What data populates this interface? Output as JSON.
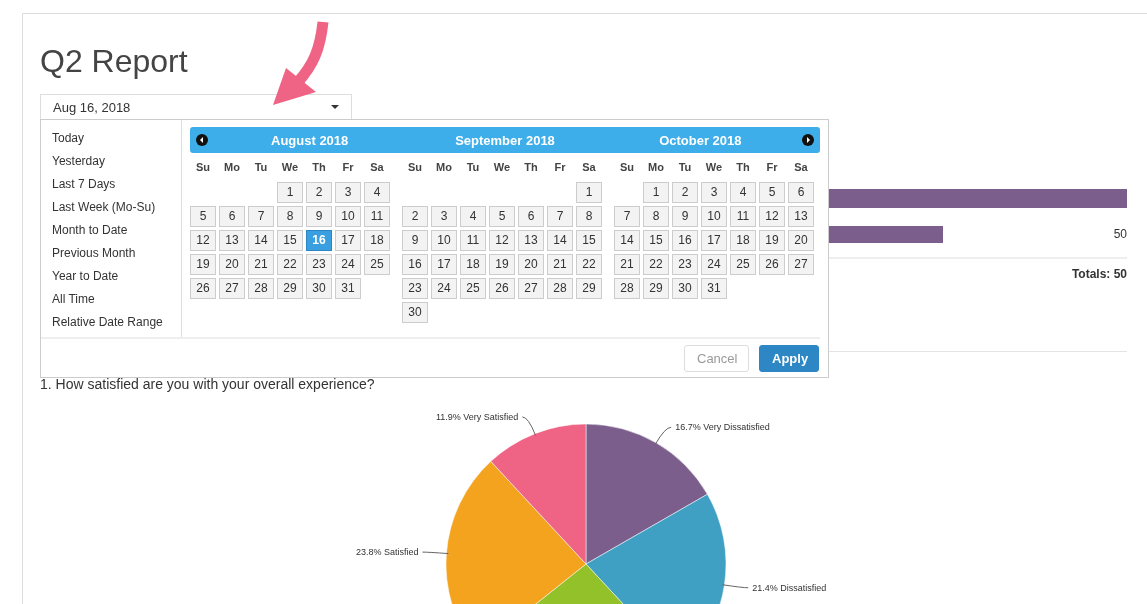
{
  "page": {
    "title": "Q2 Report"
  },
  "date_select": {
    "value": "Aug 16, 2018"
  },
  "date_picker": {
    "ranges": [
      "Today",
      "Yesterday",
      "Last 7 Days",
      "Last Week (Mo-Su)",
      "Month to Date",
      "Previous Month",
      "Year to Date",
      "All Time",
      "Relative Date Range"
    ],
    "months": [
      {
        "title": "August 2018",
        "weekdays": [
          "Su",
          "Mo",
          "Tu",
          "We",
          "Th",
          "Fr",
          "Sa"
        ],
        "weeks": [
          [
            {
              "kind": "blank"
            },
            {
              "kind": "blank"
            },
            {
              "kind": "blank"
            },
            {
              "kind": "day",
              "day": "1",
              "selected": false
            },
            {
              "kind": "day",
              "day": "2",
              "selected": false
            },
            {
              "kind": "day",
              "day": "3",
              "selected": false
            },
            {
              "kind": "day",
              "day": "4",
              "selected": false
            }
          ],
          [
            {
              "kind": "day",
              "day": "5",
              "selected": false
            },
            {
              "kind": "day",
              "day": "6",
              "selected": false
            },
            {
              "kind": "day",
              "day": "7",
              "selected": false
            },
            {
              "kind": "day",
              "day": "8",
              "selected": false
            },
            {
              "kind": "day",
              "day": "9",
              "selected": false
            },
            {
              "kind": "day",
              "day": "10",
              "selected": false
            },
            {
              "kind": "day",
              "day": "11",
              "selected": false
            }
          ],
          [
            {
              "kind": "day",
              "day": "12",
              "selected": false
            },
            {
              "kind": "day",
              "day": "13",
              "selected": false
            },
            {
              "kind": "day",
              "day": "14",
              "selected": false
            },
            {
              "kind": "day",
              "day": "15",
              "selected": false
            },
            {
              "kind": "day",
              "day": "16",
              "selected": true
            },
            {
              "kind": "day",
              "day": "17",
              "selected": false
            },
            {
              "kind": "day",
              "day": "18",
              "selected": false
            }
          ],
          [
            {
              "kind": "day",
              "day": "19",
              "selected": false
            },
            {
              "kind": "day",
              "day": "20",
              "selected": false
            },
            {
              "kind": "day",
              "day": "21",
              "selected": false
            },
            {
              "kind": "day",
              "day": "22",
              "selected": false
            },
            {
              "kind": "day",
              "day": "23",
              "selected": false
            },
            {
              "kind": "day",
              "day": "24",
              "selected": false
            },
            {
              "kind": "day",
              "day": "25",
              "selected": false
            }
          ],
          [
            {
              "kind": "day",
              "day": "26",
              "selected": false
            },
            {
              "kind": "day",
              "day": "27",
              "selected": false
            },
            {
              "kind": "day",
              "day": "28",
              "selected": false
            },
            {
              "kind": "day",
              "day": "29",
              "selected": false
            },
            {
              "kind": "day",
              "day": "30",
              "selected": false
            },
            {
              "kind": "day",
              "day": "31",
              "selected": false
            },
            {
              "kind": "blank"
            }
          ]
        ]
      },
      {
        "title": "September 2018",
        "weekdays": [
          "Su",
          "Mo",
          "Tu",
          "We",
          "Th",
          "Fr",
          "Sa"
        ],
        "weeks": [
          [
            {
              "kind": "blank"
            },
            {
              "kind": "blank"
            },
            {
              "kind": "blank"
            },
            {
              "kind": "blank"
            },
            {
              "kind": "blank"
            },
            {
              "kind": "blank"
            },
            {
              "kind": "day",
              "day": "1",
              "selected": false
            }
          ],
          [
            {
              "kind": "day",
              "day": "2",
              "selected": false
            },
            {
              "kind": "day",
              "day": "3",
              "selected": false
            },
            {
              "kind": "day",
              "day": "4",
              "selected": false
            },
            {
              "kind": "day",
              "day": "5",
              "selected": false
            },
            {
              "kind": "day",
              "day": "6",
              "selected": false
            },
            {
              "kind": "day",
              "day": "7",
              "selected": false
            },
            {
              "kind": "day",
              "day": "8",
              "selected": false
            }
          ],
          [
            {
              "kind": "day",
              "day": "9",
              "selected": false
            },
            {
              "kind": "day",
              "day": "10",
              "selected": false
            },
            {
              "kind": "day",
              "day": "11",
              "selected": false
            },
            {
              "kind": "day",
              "day": "12",
              "selected": false
            },
            {
              "kind": "day",
              "day": "13",
              "selected": false
            },
            {
              "kind": "day",
              "day": "14",
              "selected": false
            },
            {
              "kind": "day",
              "day": "15",
              "selected": false
            }
          ],
          [
            {
              "kind": "day",
              "day": "16",
              "selected": false
            },
            {
              "kind": "day",
              "day": "17",
              "selected": false
            },
            {
              "kind": "day",
              "day": "18",
              "selected": false
            },
            {
              "kind": "day",
              "day": "19",
              "selected": false
            },
            {
              "kind": "day",
              "day": "20",
              "selected": false
            },
            {
              "kind": "day",
              "day": "21",
              "selected": false
            },
            {
              "kind": "day",
              "day": "22",
              "selected": false
            }
          ],
          [
            {
              "kind": "day",
              "day": "23",
              "selected": false
            },
            {
              "kind": "day",
              "day": "24",
              "selected": false
            },
            {
              "kind": "day",
              "day": "25",
              "selected": false
            },
            {
              "kind": "day",
              "day": "26",
              "selected": false
            },
            {
              "kind": "day",
              "day": "27",
              "selected": false
            },
            {
              "kind": "day",
              "day": "28",
              "selected": false
            },
            {
              "kind": "day",
              "day": "29",
              "selected": false
            }
          ],
          [
            {
              "kind": "day",
              "day": "30",
              "selected": false
            }
          ]
        ]
      },
      {
        "title": "October 2018",
        "weekdays": [
          "Su",
          "Mo",
          "Tu",
          "We",
          "Th",
          "Fr",
          "Sa"
        ],
        "weeks": [
          [
            {
              "kind": "blank"
            },
            {
              "kind": "day",
              "day": "1",
              "selected": false
            },
            {
              "kind": "day",
              "day": "2",
              "selected": false
            },
            {
              "kind": "day",
              "day": "3",
              "selected": false
            },
            {
              "kind": "day",
              "day": "4",
              "selected": false
            },
            {
              "kind": "day",
              "day": "5",
              "selected": false
            },
            {
              "kind": "day",
              "day": "6",
              "selected": false
            }
          ],
          [
            {
              "kind": "day",
              "day": "7",
              "selected": false
            },
            {
              "kind": "day",
              "day": "8",
              "selected": false
            },
            {
              "kind": "day",
              "day": "9",
              "selected": false
            },
            {
              "kind": "day",
              "day": "10",
              "selected": false
            },
            {
              "kind": "day",
              "day": "11",
              "selected": false
            },
            {
              "kind": "day",
              "day": "12",
              "selected": false
            },
            {
              "kind": "day",
              "day": "13",
              "selected": false
            }
          ],
          [
            {
              "kind": "day",
              "day": "14",
              "selected": false
            },
            {
              "kind": "day",
              "day": "15",
              "selected": false
            },
            {
              "kind": "day",
              "day": "16",
              "selected": false
            },
            {
              "kind": "day",
              "day": "17",
              "selected": false
            },
            {
              "kind": "day",
              "day": "18",
              "selected": false
            },
            {
              "kind": "day",
              "day": "19",
              "selected": false
            },
            {
              "kind": "day",
              "day": "20",
              "selected": false
            }
          ],
          [
            {
              "kind": "day",
              "day": "21",
              "selected": false
            },
            {
              "kind": "day",
              "day": "22",
              "selected": false
            },
            {
              "kind": "day",
              "day": "23",
              "selected": false
            },
            {
              "kind": "day",
              "day": "24",
              "selected": false
            },
            {
              "kind": "day",
              "day": "25",
              "selected": false
            },
            {
              "kind": "day",
              "day": "26",
              "selected": false
            },
            {
              "kind": "day",
              "day": "27",
              "selected": false
            }
          ],
          [
            {
              "kind": "day",
              "day": "28",
              "selected": false
            },
            {
              "kind": "day",
              "day": "29",
              "selected": false
            },
            {
              "kind": "day",
              "day": "30",
              "selected": false
            },
            {
              "kind": "day",
              "day": "31",
              "selected": false
            }
          ]
        ]
      }
    ],
    "buttons": [
      {
        "label": "Cancel",
        "kind": "secondary"
      },
      {
        "label": "Apply",
        "kind": "primary"
      }
    ]
  },
  "results": {
    "value": "50",
    "totals": "Totals: 50"
  },
  "question": {
    "text": "1. How satisfied are you with your overall experience?",
    "chart_data": {
      "type": "pie",
      "values": [
        16.7,
        21.4,
        26.2,
        23.8,
        11.9
      ],
      "colors": [
        "#7b5e8c",
        "#40a0c3",
        "#93c12a",
        "#f3a31d",
        "#ef6385"
      ],
      "value_labels": [
        "16.7% Very Dissatisfied",
        "21.4% Dissatisfied",
        null,
        "23.8% Satisfied",
        "11.9% Very Satisfied"
      ]
    }
  }
}
